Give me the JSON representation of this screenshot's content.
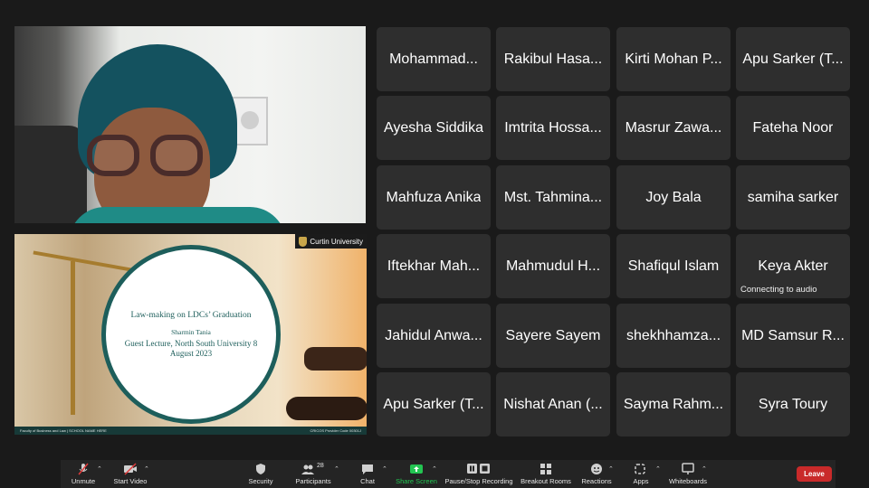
{
  "slide": {
    "brand": "Curtin University",
    "title": "Law-making on LDCs’ Graduation",
    "author": "Sharmin Tania",
    "subtitle": "Guest Lecture, North South University 8 August 2023",
    "footer_left": "Faculty of Business and Law | SCHOOL NAME HERE",
    "footer_right": "CRICOS Provider Code 00301J"
  },
  "participants": [
    {
      "name": "Mohammad..."
    },
    {
      "name": "Rakibul Hasa..."
    },
    {
      "name": "Kirti Mohan P..."
    },
    {
      "name": "Apu Sarker (T..."
    },
    {
      "name": "Ayesha Siddika"
    },
    {
      "name": "Imtrita Hossa..."
    },
    {
      "name": "Masrur Zawa..."
    },
    {
      "name": "Fateha Noor"
    },
    {
      "name": "Mahfuza Anika"
    },
    {
      "name": "Mst. Tahmina..."
    },
    {
      "name": "Joy Bala"
    },
    {
      "name": "samiha sarker"
    },
    {
      "name": "Iftekhar Mah..."
    },
    {
      "name": "Mahmudul H..."
    },
    {
      "name": "Shafiqul Islam"
    },
    {
      "name": "Keya Akter",
      "status": "Connecting to audio"
    },
    {
      "name": "Jahidul Anwa..."
    },
    {
      "name": "Sayere Sayem"
    },
    {
      "name": "shekhhamza..."
    },
    {
      "name": "MD Samsur R..."
    },
    {
      "name": "Apu Sarker (T..."
    },
    {
      "name": "Nishat Anan (..."
    },
    {
      "name": "Sayma Rahm..."
    },
    {
      "name": "Syra Toury"
    }
  ],
  "toolbar": {
    "unmute": "Unmute",
    "start_video": "Start Video",
    "security": "Security",
    "participants": "Participants",
    "participant_count": "28",
    "chat": "Chat",
    "share_screen": "Share Screen",
    "recording": "Pause/Stop Recording",
    "breakout": "Breakout Rooms",
    "reactions": "Reactions",
    "apps": "Apps",
    "whiteboards": "Whiteboards",
    "leave": "Leave"
  },
  "colors": {
    "share_green": "#23c552",
    "leave_red": "#c92a2a",
    "slide_accent": "#1d5e5b"
  }
}
